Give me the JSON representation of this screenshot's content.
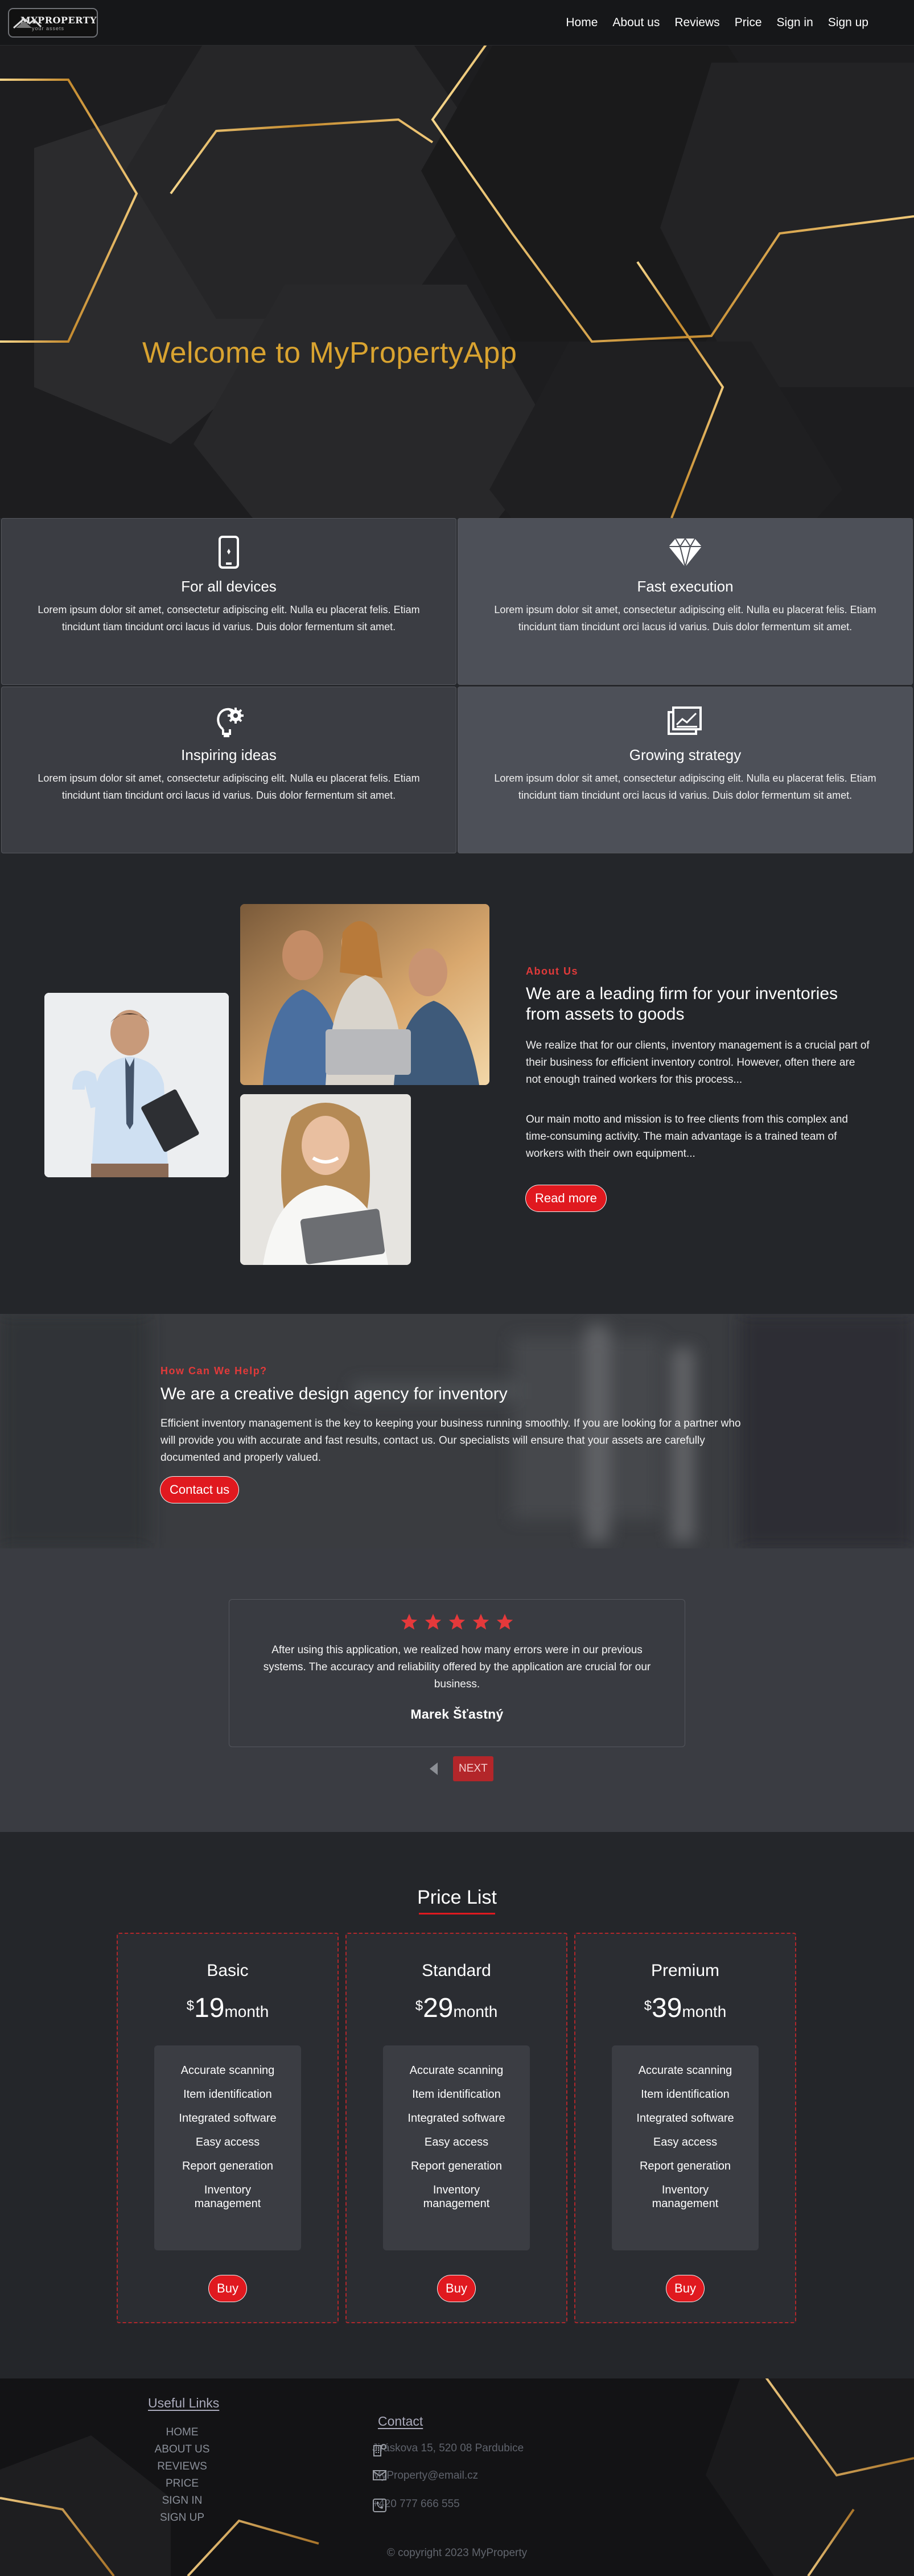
{
  "nav": {
    "logo": {
      "title": "MYPROPERTY",
      "tagline": "your assets"
    },
    "links": [
      "Home",
      "About us",
      "Reviews",
      "Price",
      "Sign in",
      "Sign up"
    ]
  },
  "hero": {
    "title": "Welcome to MyPropertyApp"
  },
  "features": [
    {
      "icon": "smartphone-icon",
      "title": "For all devices",
      "text": "Lorem ipsum dolor sit amet, consectetur adipiscing elit. Nulla eu placerat felis. Etiam tincidunt tiam tincidunt orci lacus id varius. Duis dolor fermentum sit amet."
    },
    {
      "icon": "diamond-icon",
      "title": "Fast execution",
      "text": "Lorem ipsum dolor sit amet, consectetur adipiscing elit. Nulla eu placerat felis. Etiam tincidunt tiam tincidunt orci lacus id varius. Duis dolor fermentum sit amet."
    },
    {
      "icon": "lightbulb-gear-icon",
      "title": "Inspiring ideas",
      "text": "Lorem ipsum dolor sit amet, consectetur adipiscing elit. Nulla eu placerat felis. Etiam tincidunt tiam tincidunt orci lacus id varius. Duis dolor fermentum sit amet."
    },
    {
      "icon": "chart-documents-icon",
      "title": "Growing strategy",
      "text": "Lorem ipsum dolor sit amet, consectetur adipiscing elit. Nulla eu placerat felis. Etiam tincidunt tiam tincidunt orci lacus id varius. Duis dolor fermentum sit amet."
    }
  ],
  "about": {
    "label": "About Us",
    "title": "We are a leading firm for your inventories from assets to goods",
    "p1": "We realize that for our clients, inventory management is a crucial part of their business for efficient inventory control. However, often there are not enough trained workers for this process...",
    "p2": "Our main motto and mission is to free clients from this complex and time-consuming activity. The main advantage is a trained team of workers with their own equipment...",
    "button": "Read more"
  },
  "help": {
    "label": "How Can We Help?",
    "title": "We are a creative design agency for inventory",
    "text": "Efficient inventory management is the key to keeping your business running smoothly. If you are looking for a partner who will provide you with accurate and fast results, contact us. Our specialists will ensure that your assets are carefully documented and properly valued.",
    "button": "Contact us"
  },
  "testimonial": {
    "rating": 5,
    "text": "After using this application, we realized how many errors were in our previous systems. The accuracy and reliability offered by the application are crucial for our business.",
    "author": "Marek Šťastný",
    "next_label": "NEXT"
  },
  "pricing": {
    "title": "Price List",
    "plans": [
      {
        "name": "Basic",
        "currency": "$",
        "amount": "19",
        "period": "month",
        "button": "Buy"
      },
      {
        "name": "Standard",
        "currency": "$",
        "amount": "29",
        "period": "month",
        "button": "Buy"
      },
      {
        "name": "Premium",
        "currency": "$",
        "amount": "39",
        "period": "month",
        "button": "Buy"
      }
    ],
    "features": [
      "Accurate scanning",
      "Item identification",
      "Integrated software",
      "Easy access",
      "Report generation",
      "Inventory management"
    ]
  },
  "footer": {
    "links_title": "Useful Links",
    "links": [
      "HOME",
      "ABOUT US",
      "REVIEWS",
      "PRICE",
      "SIGN IN",
      "SIGN UP"
    ],
    "contact_title": "Contact",
    "address": "Jiráskova 15, 520 08 Pardubice",
    "email": "MyProperty@email.cz",
    "phone": "+420 777 666 555",
    "copyright": "© copyright 2023 MyProperty"
  },
  "colors": {
    "accent_red": "#e0191f",
    "gold": "#d9a330",
    "dark_bg": "#24262a"
  }
}
